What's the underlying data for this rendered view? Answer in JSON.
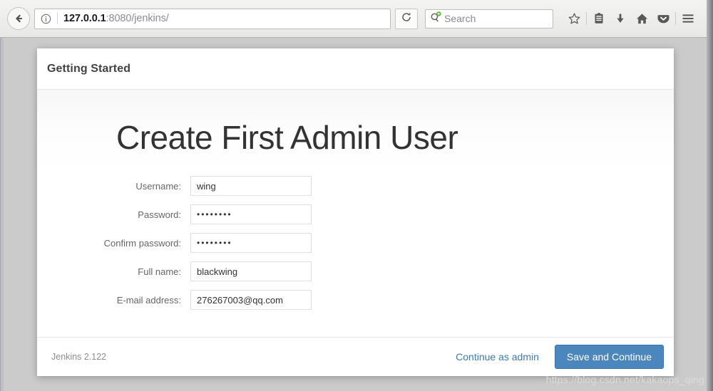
{
  "browser": {
    "back_icon": "back-arrow-icon",
    "url": {
      "info_icon": "page-info-icon",
      "host": "127.0.0.1",
      "rest": ":8080/jenkins/",
      "full": "127.0.0.1:8080/jenkins/"
    },
    "reload_icon": "reload-icon",
    "search": {
      "icon": "search-add-engine-icon",
      "placeholder": "Search",
      "value": ""
    },
    "toolbar_icons": [
      {
        "name": "bookmark-star-icon",
        "label": "Bookmark"
      },
      {
        "name": "library-icon",
        "label": "Library"
      },
      {
        "name": "downloads-icon",
        "label": "Downloads"
      },
      {
        "name": "home-icon",
        "label": "Home"
      },
      {
        "name": "pocket-icon",
        "label": "Pocket"
      },
      {
        "name": "menu-hamburger-icon",
        "label": "Open menu"
      }
    ]
  },
  "card": {
    "header_title": "Getting Started",
    "main_title": "Create First Admin User",
    "form": [
      {
        "label": "Username:",
        "value": "wing",
        "type": "text",
        "name": "username"
      },
      {
        "label": "Password:",
        "value": "••••••••",
        "type": "password",
        "name": "password"
      },
      {
        "label": "Confirm password:",
        "value": "••••••••",
        "type": "password",
        "name": "confirm-password"
      },
      {
        "label": "Full name:",
        "value": "blackwing",
        "type": "text",
        "name": "fullname"
      },
      {
        "label": "E-mail address:",
        "value": "276267003@qq.com",
        "type": "text",
        "name": "email"
      }
    ],
    "footer": {
      "version": "Jenkins 2.122",
      "secondary_label": "Continue as admin",
      "primary_label": "Save and Continue"
    }
  },
  "watermark": "https://blog.csdn.net/kakaops_qing",
  "colors": {
    "primary_button": "#4b86bd",
    "link": "#3b7ab5",
    "page_background": "#cbcbcb",
    "search_badge_green": "#5cb33a"
  }
}
